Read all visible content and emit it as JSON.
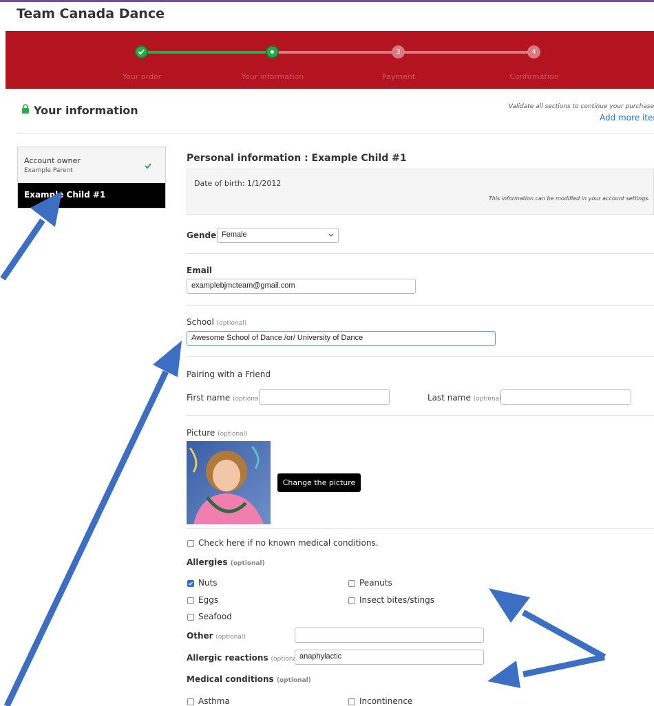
{
  "app": {
    "title": "Team Canada Dance"
  },
  "steps": [
    {
      "number": "",
      "label": "Your order",
      "state": "done"
    },
    {
      "number": "",
      "label": "Your information",
      "state": "current"
    },
    {
      "number": "3",
      "label": "Payment",
      "state": "todo"
    },
    {
      "number": "4",
      "label": "Confirmation",
      "state": "todo"
    }
  ],
  "section": {
    "title": "Your information",
    "validate_note": "Validate all sections to continue your purchase",
    "add_more": "Add more items"
  },
  "sidebar": {
    "owner_label": "Account owner",
    "owner_name": "Example Parent",
    "child_label": "Example Child #1"
  },
  "personal": {
    "heading": "Personal information : Example Child #1",
    "dob": "Date of birth: 1/1/2012",
    "modify_note": "This information can be modified in your account settings."
  },
  "gender": {
    "label": "Gender",
    "value": "Female"
  },
  "email": {
    "label": "Email",
    "value": "examplebjmcteam@gmail.com"
  },
  "school": {
    "label": "School",
    "optional": "(optional)",
    "value": "Awesome School of Dance  /or/ University of Dance"
  },
  "pairing": {
    "title": "Pairing with a Friend",
    "first_label": "First name",
    "last_label": "Last name",
    "optional": "(optional)",
    "first_value": "",
    "last_value": ""
  },
  "picture": {
    "label": "Picture",
    "optional": "(optional)",
    "button": "Change the picture"
  },
  "medical": {
    "no_conditions": "Check here if no known medical conditions.",
    "allergies_label": "Allergies",
    "allergies_optional": "(optional)",
    "allergies": [
      {
        "label": "Nuts",
        "checked": true
      },
      {
        "label": "Peanuts",
        "checked": false
      },
      {
        "label": "Eggs",
        "checked": false
      },
      {
        "label": "Insect bites/stings",
        "checked": false
      },
      {
        "label": "Seafood",
        "checked": false
      }
    ],
    "other_label": "Other",
    "other_optional": "(optional)",
    "other_value": "",
    "reactions_label": "Allergic reactions",
    "reactions_optional": "(optional)",
    "reactions_value": "anaphylactic",
    "conditions_label": "Medical conditions",
    "conditions_optional": "(optional)",
    "conditions": [
      {
        "label": "Asthma",
        "checked": false
      },
      {
        "label": "Incontinence",
        "checked": false
      }
    ]
  },
  "colors": {
    "banner": "#b3141f",
    "done": "#2da84a",
    "link": "#1a73e8",
    "arrow": "#3c6fc4"
  }
}
